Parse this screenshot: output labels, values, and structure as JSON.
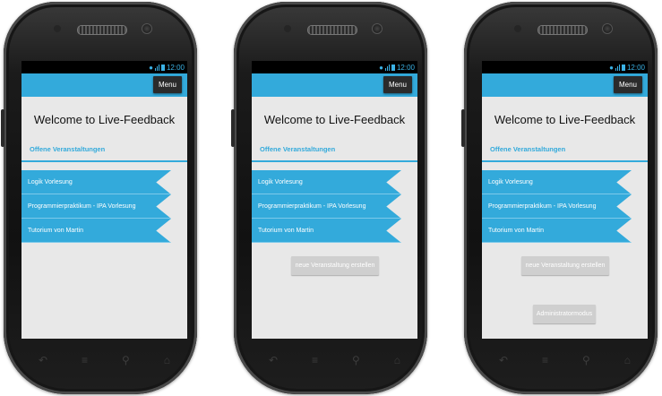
{
  "status": {
    "time": "12:00"
  },
  "action_bar": {
    "menu_label": "Menu"
  },
  "screen": {
    "title": "Welcome to Live-Feedback",
    "section_header": "Offene Veranstaltungen",
    "events": [
      "Logik Vorlesung",
      "Programmierpraktikum - IPA Vorlesung",
      "Tutorium von Martin"
    ]
  },
  "buttons": {
    "create_event": "neue Veranstaltung erstellen",
    "admin_mode": "Administratormodus"
  },
  "nav_icons": [
    "back-icon",
    "home-icon",
    "search-icon",
    "recent-apps-icon"
  ],
  "colors": {
    "accent": "#33aadb",
    "button_gray": "#cfcfcf",
    "screen_bg": "#e8e8e8"
  }
}
